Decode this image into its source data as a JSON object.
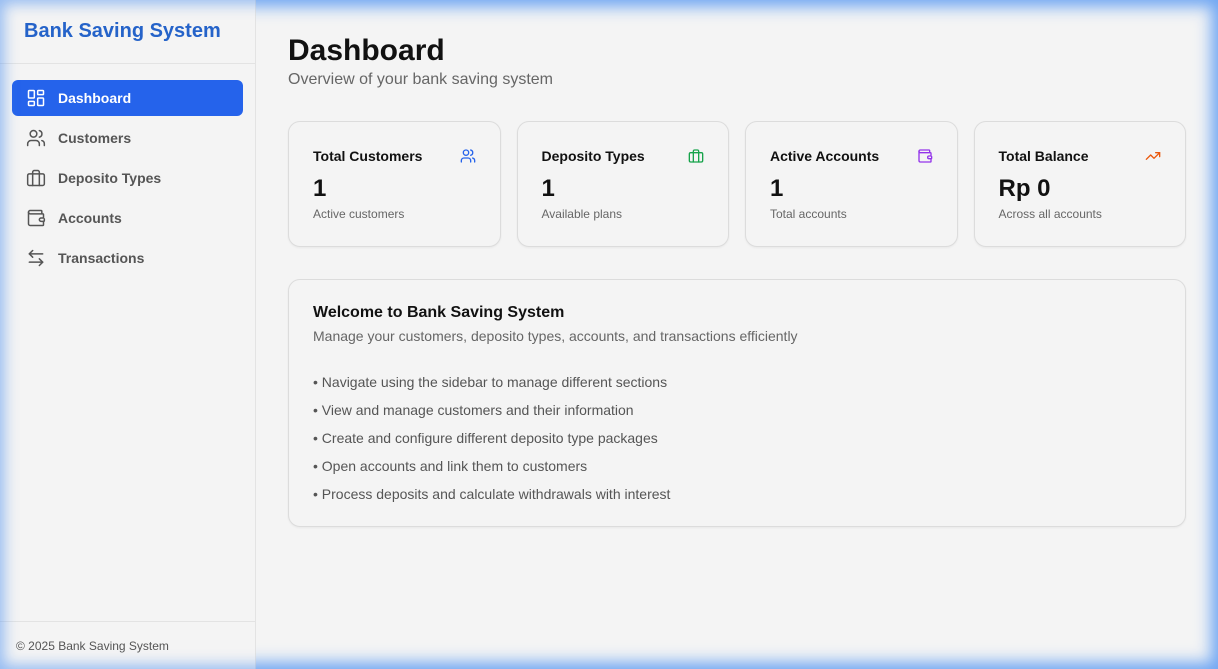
{
  "app": {
    "brand": "Bank Saving System"
  },
  "sidebar": {
    "items": [
      {
        "label": "Dashboard",
        "icon": "dashboard-grid-icon",
        "active": true
      },
      {
        "label": "Customers",
        "icon": "users-icon"
      },
      {
        "label": "Deposito Types",
        "icon": "briefcase-icon"
      },
      {
        "label": "Accounts",
        "icon": "wallet-icon"
      },
      {
        "label": "Transactions",
        "icon": "arrows-left-right-icon"
      }
    ],
    "footer": "© 2025 Bank Saving System"
  },
  "header": {
    "title": "Dashboard",
    "subtitle": "Overview of your bank saving system"
  },
  "stats": [
    {
      "label": "Total Customers",
      "value": "1",
      "note": "Active customers",
      "icon": "users-icon",
      "color": "#2563eb"
    },
    {
      "label": "Deposito Types",
      "value": "1",
      "note": "Available plans",
      "icon": "briefcase-icon",
      "color": "#16a34a"
    },
    {
      "label": "Active Accounts",
      "value": "1",
      "note": "Total accounts",
      "icon": "wallet-icon",
      "color": "#9333ea"
    },
    {
      "label": "Total Balance",
      "value": "Rp 0",
      "note": "Across all accounts",
      "icon": "trending-up-icon",
      "color": "#ea580c"
    }
  ],
  "welcome": {
    "title": "Welcome to Bank Saving System",
    "description": "Manage your customers, deposito types, accounts, and transactions efficiently",
    "items": [
      "• Navigate using the sidebar to manage different sections",
      "• View and manage customers and their information",
      "• Create and configure different deposito type packages",
      "• Open accounts and link them to customers",
      "• Process deposits and calculate withdrawals with interest"
    ]
  },
  "colors": {
    "accent": "#2563eb",
    "brand": "#2563c9"
  }
}
